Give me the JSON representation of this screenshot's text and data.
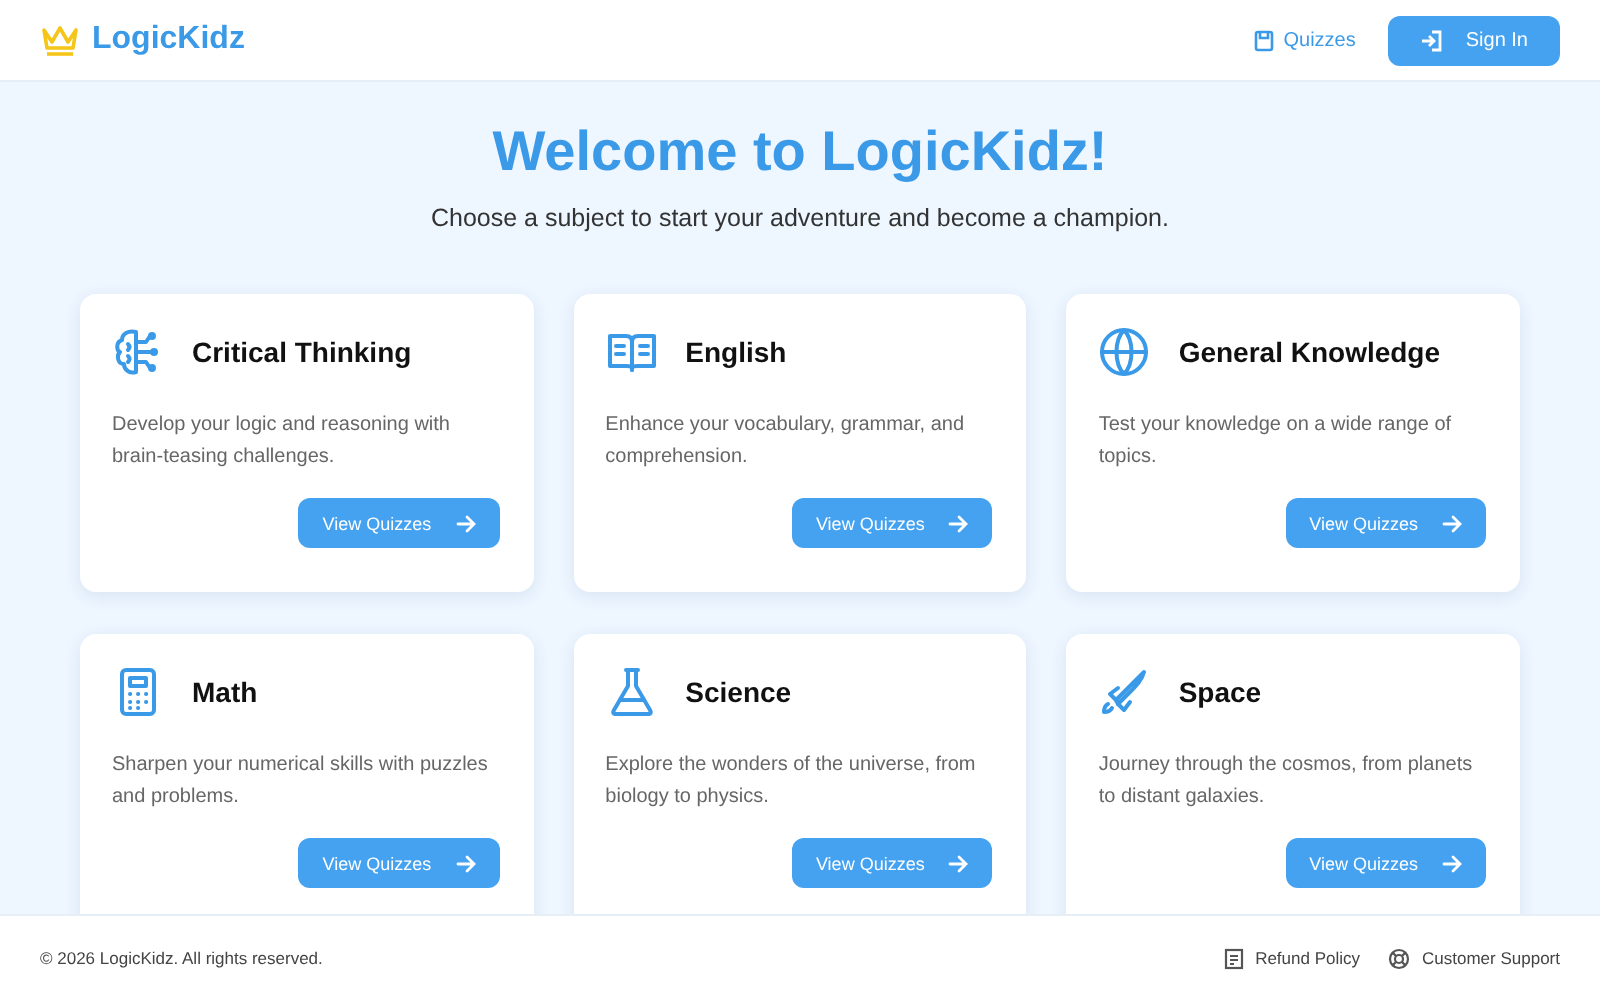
{
  "header": {
    "brand": "LogicKidz",
    "nav": [
      {
        "label": "Quizzes",
        "kind": "link"
      },
      {
        "label": "Sign In",
        "kind": "button"
      }
    ]
  },
  "hero": {
    "title": "Welcome to LogicKidz!",
    "subtitle": "Choose a subject to start your adventure and become a champion."
  },
  "subjects": [
    {
      "title": "Critical Thinking",
      "description": "Develop your logic and reasoning with brain-teasing challenges.",
      "action": "View Quizzes"
    },
    {
      "title": "English",
      "description": "Enhance your vocabulary, grammar, and comprehension.",
      "action": "View Quizzes"
    },
    {
      "title": "General Knowledge",
      "description": "Test your knowledge on a wide range of topics.",
      "action": "View Quizzes"
    },
    {
      "title": "Math",
      "description": "Sharpen your numerical skills with puzzles and problems.",
      "action": "View Quizzes"
    },
    {
      "title": "Science",
      "description": "Explore the wonders of the universe, from biology to physics.",
      "action": "View Quizzes"
    },
    {
      "title": "Space",
      "description": "Journey through the cosmos, from planets to distant galaxies.",
      "action": "View Quizzes"
    }
  ],
  "footer": {
    "copyright": "© 2026 LogicKidz. All rights reserved.",
    "links": [
      "Refund Policy",
      "Customer Support"
    ]
  }
}
